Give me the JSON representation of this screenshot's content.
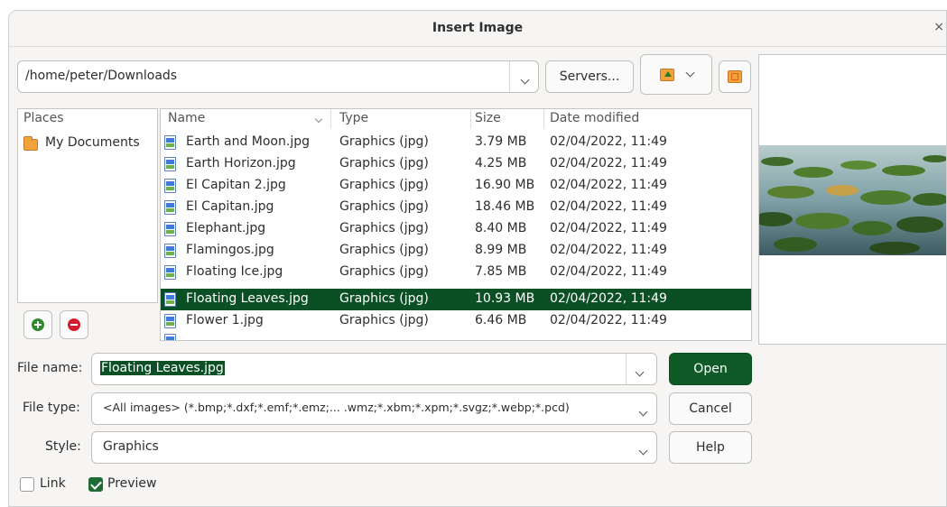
{
  "window": {
    "title": "Insert Image",
    "close_glyph": "×"
  },
  "path": {
    "value": "/home/peter/Downloads"
  },
  "toolbar": {
    "servers_label": "Servers..."
  },
  "places": {
    "header": "Places",
    "items": [
      {
        "label": "My Documents",
        "icon": "folder-icon"
      }
    ]
  },
  "files": {
    "columns": {
      "name": "Name",
      "type": "Type",
      "size": "Size",
      "date": "Date modified"
    },
    "rows": [
      {
        "name": "Earth and Moon.jpg",
        "type": "Graphics (jpg)",
        "size": "3.79 MB",
        "date": "02/04/2022, 11:49"
      },
      {
        "name": "Earth Horizon.jpg",
        "type": "Graphics (jpg)",
        "size": "4.25 MB",
        "date": "02/04/2022, 11:49"
      },
      {
        "name": "El Capitan 2.jpg",
        "type": "Graphics (jpg)",
        "size": "16.90 MB",
        "date": "02/04/2022, 11:49"
      },
      {
        "name": "El Capitan.jpg",
        "type": "Graphics (jpg)",
        "size": "18.46 MB",
        "date": "02/04/2022, 11:49"
      },
      {
        "name": "Elephant.jpg",
        "type": "Graphics (jpg)",
        "size": "8.40 MB",
        "date": "02/04/2022, 11:49"
      },
      {
        "name": "Flamingos.jpg",
        "type": "Graphics (jpg)",
        "size": "8.99 MB",
        "date": "02/04/2022, 11:49"
      },
      {
        "name": "Floating Ice.jpg",
        "type": "Graphics (jpg)",
        "size": "7.85 MB",
        "date": "02/04/2022, 11:49"
      },
      {
        "name": "Floating Leaves.jpg",
        "type": "Graphics (jpg)",
        "size": "10.93 MB",
        "date": "02/04/2022, 11:49",
        "selected": true
      },
      {
        "name": "Flower 1.jpg",
        "type": "Graphics (jpg)",
        "size": "6.46 MB",
        "date": "02/04/2022, 11:49"
      }
    ]
  },
  "form": {
    "file_name_label": "File name:",
    "file_name_value": "Floating Leaves.jpg",
    "file_type_label": "File type:",
    "file_type_value": "<All images> (*.bmp;*.dxf;*.emf;*.emz;... .wmz;*.xbm;*.xpm;*.svgz;*.webp;*.pcd)",
    "style_label": "Style:",
    "style_value": "Graphics"
  },
  "buttons": {
    "open": "Open",
    "cancel": "Cancel",
    "help": "Help"
  },
  "options": {
    "link_label": "Link",
    "preview_label": "Preview",
    "link_checked": false,
    "preview_checked": true
  },
  "colors": {
    "accent": "#0b4f24",
    "open_button_bg": "#0f5a26",
    "selection_bg": "#0b4f24"
  }
}
